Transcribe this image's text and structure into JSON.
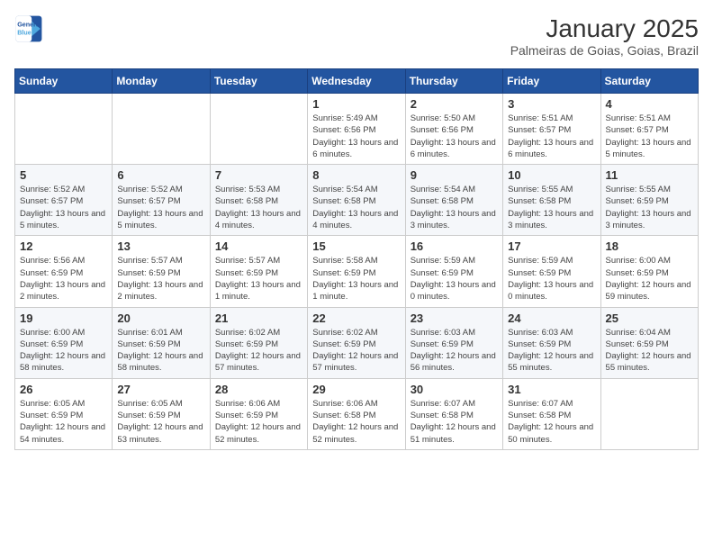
{
  "header": {
    "logo_line1": "General",
    "logo_line2": "Blue",
    "title": "January 2025",
    "subtitle": "Palmeiras de Goias, Goias, Brazil"
  },
  "weekdays": [
    "Sunday",
    "Monday",
    "Tuesday",
    "Wednesday",
    "Thursday",
    "Friday",
    "Saturday"
  ],
  "weeks": [
    [
      {
        "day": "",
        "info": ""
      },
      {
        "day": "",
        "info": ""
      },
      {
        "day": "",
        "info": ""
      },
      {
        "day": "1",
        "info": "Sunrise: 5:49 AM\nSunset: 6:56 PM\nDaylight: 13 hours and 6 minutes."
      },
      {
        "day": "2",
        "info": "Sunrise: 5:50 AM\nSunset: 6:56 PM\nDaylight: 13 hours and 6 minutes."
      },
      {
        "day": "3",
        "info": "Sunrise: 5:51 AM\nSunset: 6:57 PM\nDaylight: 13 hours and 6 minutes."
      },
      {
        "day": "4",
        "info": "Sunrise: 5:51 AM\nSunset: 6:57 PM\nDaylight: 13 hours and 5 minutes."
      }
    ],
    [
      {
        "day": "5",
        "info": "Sunrise: 5:52 AM\nSunset: 6:57 PM\nDaylight: 13 hours and 5 minutes."
      },
      {
        "day": "6",
        "info": "Sunrise: 5:52 AM\nSunset: 6:57 PM\nDaylight: 13 hours and 5 minutes."
      },
      {
        "day": "7",
        "info": "Sunrise: 5:53 AM\nSunset: 6:58 PM\nDaylight: 13 hours and 4 minutes."
      },
      {
        "day": "8",
        "info": "Sunrise: 5:54 AM\nSunset: 6:58 PM\nDaylight: 13 hours and 4 minutes."
      },
      {
        "day": "9",
        "info": "Sunrise: 5:54 AM\nSunset: 6:58 PM\nDaylight: 13 hours and 3 minutes."
      },
      {
        "day": "10",
        "info": "Sunrise: 5:55 AM\nSunset: 6:58 PM\nDaylight: 13 hours and 3 minutes."
      },
      {
        "day": "11",
        "info": "Sunrise: 5:55 AM\nSunset: 6:59 PM\nDaylight: 13 hours and 3 minutes."
      }
    ],
    [
      {
        "day": "12",
        "info": "Sunrise: 5:56 AM\nSunset: 6:59 PM\nDaylight: 13 hours and 2 minutes."
      },
      {
        "day": "13",
        "info": "Sunrise: 5:57 AM\nSunset: 6:59 PM\nDaylight: 13 hours and 2 minutes."
      },
      {
        "day": "14",
        "info": "Sunrise: 5:57 AM\nSunset: 6:59 PM\nDaylight: 13 hours and 1 minute."
      },
      {
        "day": "15",
        "info": "Sunrise: 5:58 AM\nSunset: 6:59 PM\nDaylight: 13 hours and 1 minute."
      },
      {
        "day": "16",
        "info": "Sunrise: 5:59 AM\nSunset: 6:59 PM\nDaylight: 13 hours and 0 minutes."
      },
      {
        "day": "17",
        "info": "Sunrise: 5:59 AM\nSunset: 6:59 PM\nDaylight: 13 hours and 0 minutes."
      },
      {
        "day": "18",
        "info": "Sunrise: 6:00 AM\nSunset: 6:59 PM\nDaylight: 12 hours and 59 minutes."
      }
    ],
    [
      {
        "day": "19",
        "info": "Sunrise: 6:00 AM\nSunset: 6:59 PM\nDaylight: 12 hours and 58 minutes."
      },
      {
        "day": "20",
        "info": "Sunrise: 6:01 AM\nSunset: 6:59 PM\nDaylight: 12 hours and 58 minutes."
      },
      {
        "day": "21",
        "info": "Sunrise: 6:02 AM\nSunset: 6:59 PM\nDaylight: 12 hours and 57 minutes."
      },
      {
        "day": "22",
        "info": "Sunrise: 6:02 AM\nSunset: 6:59 PM\nDaylight: 12 hours and 57 minutes."
      },
      {
        "day": "23",
        "info": "Sunrise: 6:03 AM\nSunset: 6:59 PM\nDaylight: 12 hours and 56 minutes."
      },
      {
        "day": "24",
        "info": "Sunrise: 6:03 AM\nSunset: 6:59 PM\nDaylight: 12 hours and 55 minutes."
      },
      {
        "day": "25",
        "info": "Sunrise: 6:04 AM\nSunset: 6:59 PM\nDaylight: 12 hours and 55 minutes."
      }
    ],
    [
      {
        "day": "26",
        "info": "Sunrise: 6:05 AM\nSunset: 6:59 PM\nDaylight: 12 hours and 54 minutes."
      },
      {
        "day": "27",
        "info": "Sunrise: 6:05 AM\nSunset: 6:59 PM\nDaylight: 12 hours and 53 minutes."
      },
      {
        "day": "28",
        "info": "Sunrise: 6:06 AM\nSunset: 6:59 PM\nDaylight: 12 hours and 52 minutes."
      },
      {
        "day": "29",
        "info": "Sunrise: 6:06 AM\nSunset: 6:58 PM\nDaylight: 12 hours and 52 minutes."
      },
      {
        "day": "30",
        "info": "Sunrise: 6:07 AM\nSunset: 6:58 PM\nDaylight: 12 hours and 51 minutes."
      },
      {
        "day": "31",
        "info": "Sunrise: 6:07 AM\nSunset: 6:58 PM\nDaylight: 12 hours and 50 minutes."
      },
      {
        "day": "",
        "info": ""
      }
    ]
  ]
}
